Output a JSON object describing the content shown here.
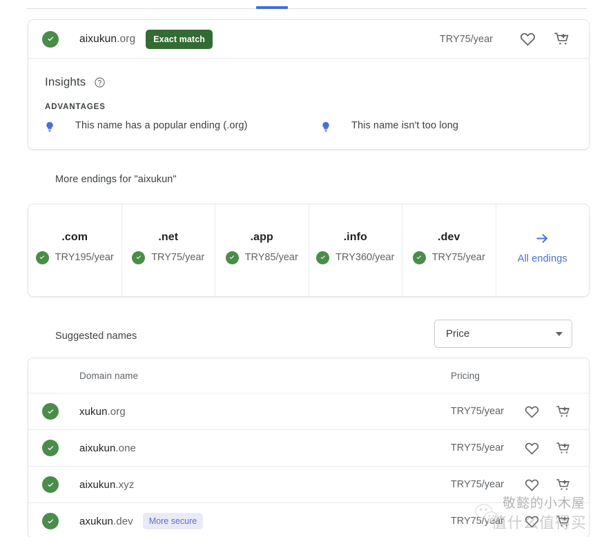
{
  "tabstrip": {
    "active_tab_indicator": true,
    "accent_color": "#3f6fd8"
  },
  "exact_match": {
    "status_icon": "check-circle-icon",
    "domain_sld": "aixukun",
    "domain_tld": ".org",
    "badge_label": "Exact match",
    "badge_color": "#336b33",
    "price": "TRY75/year",
    "favorite_icon": "heart-icon",
    "cart_icon": "add-to-cart-icon"
  },
  "insights": {
    "title": "Insights",
    "help_icon": "help-circle-icon",
    "section_label": "ADVANTAGES",
    "items": [
      {
        "icon": "lightbulb-icon",
        "text": "This name has a popular ending (.org)"
      },
      {
        "icon": "lightbulb-icon",
        "text": "This name isn't too long"
      }
    ],
    "bulb_color": "#4a6fd4"
  },
  "more_endings": {
    "label": "More endings for \"aixukun\"",
    "cards": [
      {
        "tld": ".com",
        "price": "TRY195/year",
        "status_icon": "check-circle-icon"
      },
      {
        "tld": ".net",
        "price": "TRY75/year",
        "status_icon": "check-circle-icon"
      },
      {
        "tld": ".app",
        "price": "TRY85/year",
        "status_icon": "check-circle-icon"
      },
      {
        "tld": ".info",
        "price": "TRY360/year",
        "status_icon": "check-circle-icon"
      },
      {
        "tld": ".dev",
        "price": "TRY75/year",
        "status_icon": "check-circle-icon"
      }
    ],
    "all_endings": {
      "label": "All endings",
      "icon": "arrow-right-icon",
      "color": "#4a6fd4"
    }
  },
  "suggested": {
    "label": "Suggested names",
    "sort": {
      "value": "Price",
      "icon": "chevron-down-icon"
    },
    "columns": {
      "domain": "Domain name",
      "pricing": "Pricing"
    },
    "rows": [
      {
        "status_icon": "check-circle-icon",
        "sld": "xukun",
        "tld": ".org",
        "tag": "",
        "price": "TRY75/year",
        "favorite_icon": "heart-icon",
        "cart_icon": "add-to-cart-icon"
      },
      {
        "status_icon": "check-circle-icon",
        "sld": "aixukun",
        "tld": ".one",
        "tag": "",
        "price": "TRY75/year",
        "favorite_icon": "heart-icon",
        "cart_icon": "add-to-cart-icon"
      },
      {
        "status_icon": "check-circle-icon",
        "sld": "aixukun",
        "tld": ".xyz",
        "tag": "",
        "price": "TRY75/year",
        "favorite_icon": "heart-icon",
        "cart_icon": "add-to-cart-icon"
      },
      {
        "status_icon": "check-circle-icon",
        "sld": "axukun",
        "tld": ".dev",
        "tag": "More secure",
        "price": "TRY75/year",
        "favorite_icon": "heart-icon",
        "cart_icon": "add-to-cart-icon"
      }
    ]
  },
  "watermark": {
    "top_text": "敬懿的小木屋",
    "bottom_text": "值什么值得买",
    "logo_icon": "wechat-icon"
  },
  "colors": {
    "check_green": "#4a8c4a",
    "badge_green": "#336b33",
    "link_blue": "#4a6fd4",
    "tag_bg": "#e8eaf8",
    "tag_fg": "#5f6fc0",
    "text_primary": "#202124",
    "text_secondary": "#5f6368",
    "border": "#e8eaed"
  }
}
